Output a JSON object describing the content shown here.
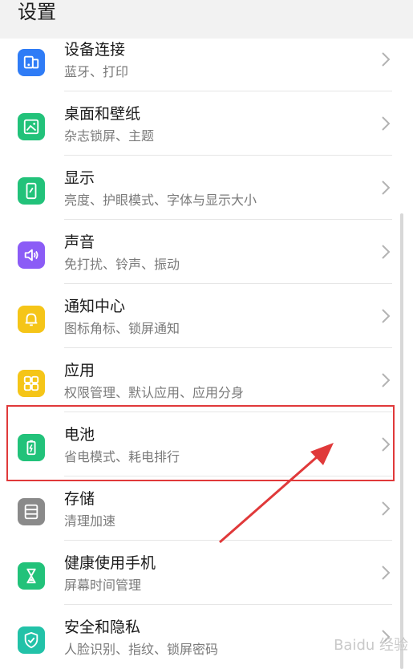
{
  "header": {
    "title": "设置"
  },
  "items": [
    {
      "id": "device-connection",
      "label": "设备连接",
      "sub": "蓝牙、打印",
      "icon": "device-connection-icon",
      "color": "#2f7cf6"
    },
    {
      "id": "wallpaper",
      "label": "桌面和壁纸",
      "sub": "杂志锁屏、主题",
      "icon": "wallpaper-icon",
      "color": "#22c27a"
    },
    {
      "id": "display",
      "label": "显示",
      "sub": "亮度、护眼模式、字体与显示大小",
      "icon": "display-icon",
      "color": "#22c27a"
    },
    {
      "id": "sound",
      "label": "声音",
      "sub": "免打扰、铃声、振动",
      "icon": "sound-icon",
      "color": "#8b5cf6"
    },
    {
      "id": "notification",
      "label": "通知中心",
      "sub": "图标角标、锁屏通知",
      "icon": "notification-icon",
      "color": "#f5c518"
    },
    {
      "id": "apps",
      "label": "应用",
      "sub": "权限管理、默认应用、应用分身",
      "icon": "apps-icon",
      "color": "#f5c518"
    },
    {
      "id": "battery",
      "label": "电池",
      "sub": "省电模式、耗电排行",
      "icon": "battery-icon",
      "color": "#22c27a"
    },
    {
      "id": "storage",
      "label": "存储",
      "sub": "清理加速",
      "icon": "storage-icon",
      "color": "#8a8a8a"
    },
    {
      "id": "digital-balance",
      "label": "健康使用手机",
      "sub": "屏幕时间管理",
      "icon": "hourglass-icon",
      "color": "#22c27a"
    },
    {
      "id": "security",
      "label": "安全和隐私",
      "sub": "人脸识别、指纹、锁屏密码",
      "icon": "shield-icon",
      "color": "#22c2a8"
    }
  ],
  "watermark": "Baidu 经验",
  "accent_highlight": "#e0393a"
}
